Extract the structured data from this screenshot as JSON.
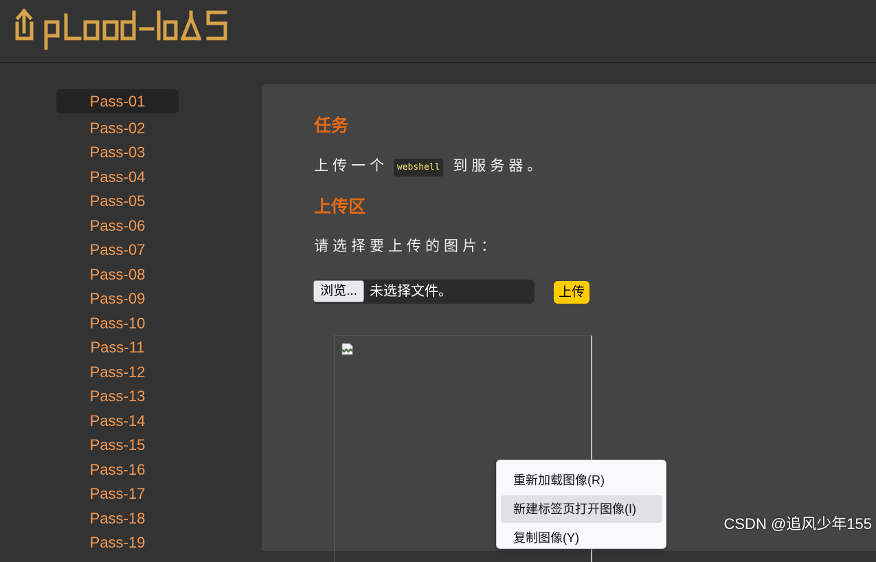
{
  "header": {
    "logo_text": "Upload-labs",
    "logo_color": "#d6a24a"
  },
  "sidebar": {
    "items": [
      {
        "label": "Pass-01",
        "active": true
      },
      {
        "label": "Pass-02"
      },
      {
        "label": "Pass-03"
      },
      {
        "label": "Pass-04"
      },
      {
        "label": "Pass-05"
      },
      {
        "label": "Pass-06"
      },
      {
        "label": "Pass-07"
      },
      {
        "label": "Pass-08"
      },
      {
        "label": "Pass-09"
      },
      {
        "label": "Pass-10"
      },
      {
        "label": "Pass-11"
      },
      {
        "label": "Pass-12"
      },
      {
        "label": "Pass-13"
      },
      {
        "label": "Pass-14"
      },
      {
        "label": "Pass-15"
      },
      {
        "label": "Pass-16"
      },
      {
        "label": "Pass-17"
      },
      {
        "label": "Pass-18"
      },
      {
        "label": "Pass-19"
      }
    ],
    "item_color": "#f59a52"
  },
  "main": {
    "task_heading": "任务",
    "task_text_before": "上传一个",
    "task_code": "webshell",
    "task_text_after": "到服务器。",
    "upload_heading": "上传区",
    "select_prompt": "请选择要上传的图片：",
    "browse_label": "浏览...",
    "file_status": "未选择文件。",
    "upload_button": "上传",
    "heading_color": "#e86a10",
    "button_color": "#ffcc00",
    "broken_image_icon": "broken-image-icon"
  },
  "context_menu": {
    "items": [
      {
        "label": "重新加载图像(R)"
      },
      {
        "label": "新建标签页打开图像(I)",
        "hovered": true
      },
      {
        "label": "复制图像(Y)"
      }
    ]
  },
  "watermark": "CSDN @追风少年155"
}
